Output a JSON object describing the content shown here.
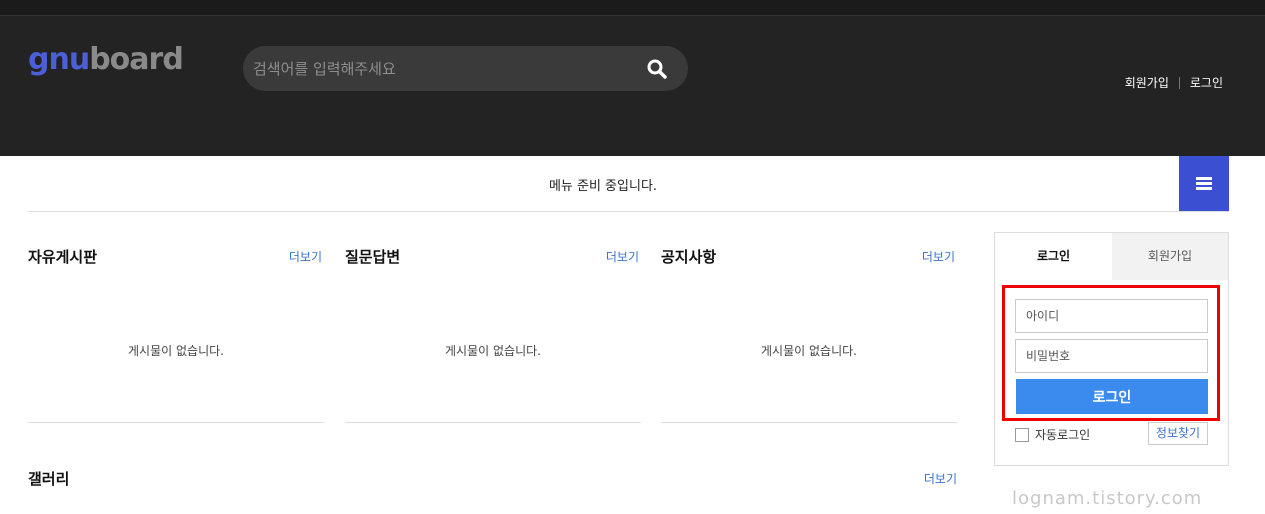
{
  "header": {
    "logo_part1": "gnu",
    "logo_part2": "board",
    "search_placeholder": "검색어를 입력해주세요",
    "links": {
      "join": "회원가입",
      "login": "로그인"
    }
  },
  "nav": {
    "message": "메뉴 준비 중입니다."
  },
  "boards": [
    {
      "title": "자유게시판",
      "more": "더보기",
      "empty": "게시물이 없습니다."
    },
    {
      "title": "질문답변",
      "more": "더보기",
      "empty": "게시물이 없습니다."
    },
    {
      "title": "공지사항",
      "more": "더보기",
      "empty": "게시물이 없습니다."
    }
  ],
  "gallery": {
    "title": "갤러리",
    "more": "더보기"
  },
  "login_box": {
    "tab_login": "로그인",
    "tab_join": "회원가입",
    "id_placeholder": "아이디",
    "pw_placeholder": "비밀번호",
    "submit": "로그인",
    "auto_login": "자동로그인",
    "find_info": "정보찾기"
  },
  "watermark": "lognam.tistory.com",
  "colors": {
    "header_bg": "#232323",
    "accent": "#3a4fd1",
    "button": "#3b8bef",
    "highlight": "#ee0000"
  },
  "icons": {
    "search": "search-icon",
    "menu": "hamburger-icon"
  }
}
